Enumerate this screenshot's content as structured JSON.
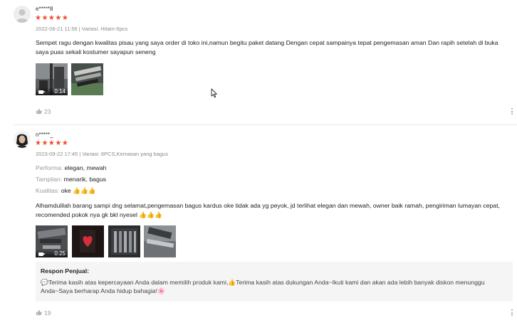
{
  "reviews": [
    {
      "username": "e*****8",
      "rating": "★★★★★",
      "meta": "2022-06-21 11:56 | Variasi: Hitam-6pcs",
      "text": "Sempet ragu dengan kwalitas pisau yang saya order di toko ini,namun begitu paket datang Dengan cepat sampainya tepat pengemasan aman Dan rapih setelah di buka saya puas sekali kostumer sayapun seneng",
      "media": [
        {
          "type": "video",
          "duration": "0:14"
        },
        {
          "type": "image"
        }
      ],
      "likes": "23"
    },
    {
      "username": "n*****_",
      "rating": "★★★★★",
      "meta": "2023-09-22 17:45 | Variasi: 6PCS,Kemasan yang bagus",
      "attributes": [
        {
          "key": "Performa:",
          "value": "elegan, mewah"
        },
        {
          "key": "Tampilan:",
          "value": "menarik, bagus"
        },
        {
          "key": "Kualitas:",
          "value": "oke 👍👍👍"
        }
      ],
      "text": "Alhamdulilah barang sampi dng selamat,pengemasan bagus kardus oke tidak ada yg peyok, jd terlihat elegan dan mewah, owner baik ramah, pengiriman lumayan cepat, recomended pokok nya gk bkl nyesel 👍👍👍",
      "media": [
        {
          "type": "video",
          "duration": "0:25"
        },
        {
          "type": "image"
        },
        {
          "type": "image"
        },
        {
          "type": "image"
        }
      ],
      "seller_reply": {
        "title": "Respon Penjual:",
        "text": "💬Terima kasih atas kepercayaan Anda dalam memilih produk kami,👍Terima kasih atas dukungan Anda~Ikuti kami dan akan ada lebih banyak diskon menunggu Anda~Saya berharap Anda hidup bahagia!🌸"
      },
      "likes": "19"
    }
  ],
  "colors": {
    "star": "#ee4d2d",
    "meta": "#8a8a8a",
    "reply_bg": "#f5f5f5"
  },
  "icons": [
    "user-avatar-icon",
    "star-icon",
    "video-camera-icon",
    "like-thumb-icon",
    "more-vertical-icon",
    "mouse-cursor-icon"
  ]
}
